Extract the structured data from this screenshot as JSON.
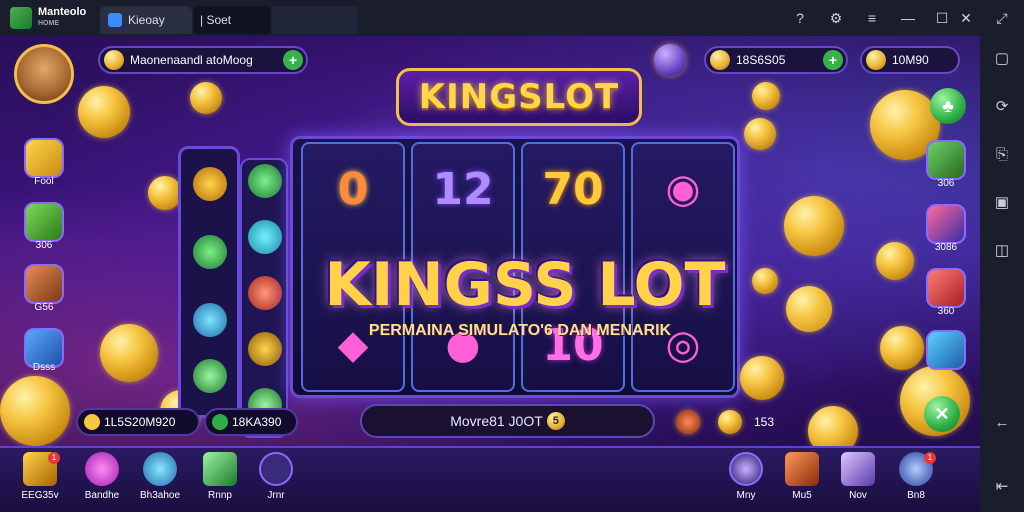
{
  "window": {
    "app_name": "Manteolo",
    "app_sub": "HOME",
    "tabs": [
      {
        "label": "Kieoay"
      },
      {
        "label": "| Soet"
      },
      {
        "label": ""
      }
    ],
    "controls": {
      "help_icon": "?",
      "menu_icon": "≡",
      "minimize_icon": "—",
      "maximize_icon": "☐",
      "close_icon": "✕",
      "expand_icon": "⤢"
    }
  },
  "hud": {
    "player_name": "Maonenaandl atoMoog",
    "balance_1": "18S6S05",
    "balance_2": "10M90",
    "plus": "+"
  },
  "title": {
    "logo": "KINGSLOT",
    "big": "KINGSS LOT",
    "subtitle": "PERMAINA  SIMULATO'6 DAN MENARIK"
  },
  "left_menu": [
    {
      "label": "Fool"
    },
    {
      "label": "306"
    },
    {
      "label": "G56"
    },
    {
      "label": "Dsss"
    }
  ],
  "right_menu": [
    {
      "label": "306"
    },
    {
      "label": "3086"
    },
    {
      "label": "360"
    },
    {
      "label": ""
    }
  ],
  "reels": {
    "symbols_top": [
      "0",
      "12",
      "70",
      ""
    ],
    "symbols_bottom": [
      "",
      "",
      "10",
      ""
    ]
  },
  "bottom_panel": {
    "text": "Movre81 J0OT",
    "badge": "5"
  },
  "stats": {
    "left_value": "1L5S20M920",
    "mid_value": "18KA390",
    "right_value": "153"
  },
  "bottom_bar": [
    {
      "label": "EEG35v",
      "badge": "1"
    },
    {
      "label": "Bandhe"
    },
    {
      "label": "Bh3ahoe"
    },
    {
      "label": "Rnnp"
    },
    {
      "label": "Jrnr"
    },
    {
      "label": "Mny"
    },
    {
      "label": "Mu5"
    },
    {
      "label": "Nov"
    },
    {
      "label": "Bn8",
      "badge": "1"
    }
  ],
  "colors": {
    "gold": "#ffd54a",
    "purple": "#3b1580",
    "accent": "#6a45c7",
    "green": "#2dae45"
  }
}
